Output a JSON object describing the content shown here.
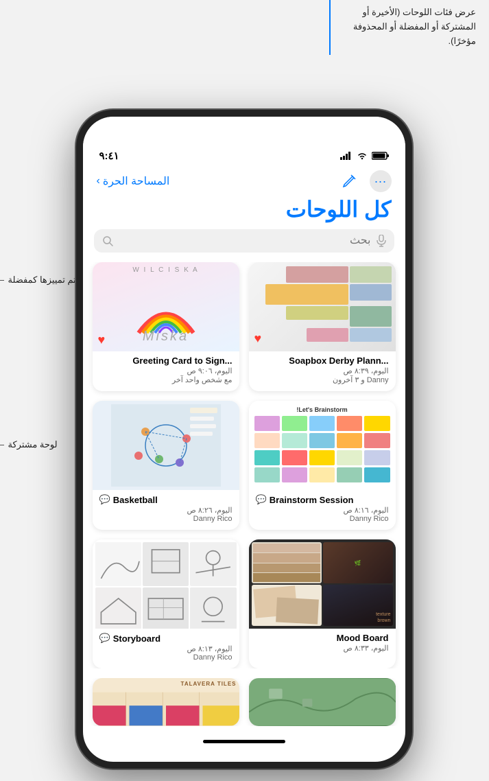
{
  "annotations": {
    "top": {
      "text": "عرض فئات اللوحات (الأخيرة أو المشتركة أو المفضلة أو المحذوفة مؤخرًا)."
    },
    "left_favorite": {
      "text": "لوحة تم تمييزها كمفضلة"
    },
    "left_shared": {
      "text": "لوحة مشتركة"
    }
  },
  "status_bar": {
    "time": "٩:٤١",
    "battery": "██",
    "wifi": "wifi",
    "signal": "signal"
  },
  "nav": {
    "back_label": "المساحة الحرة",
    "more_icon": "⋯",
    "compose_icon": "✎"
  },
  "page_title": "كل اللوحات",
  "search": {
    "placeholder": "بحث",
    "mic_label": "mic"
  },
  "boards": [
    {
      "id": "soapbox",
      "title": "...Soapbox Derby Plann",
      "date": "اليوم، ٨:٣٩ ص",
      "author": "Danny و ٣ آخرون",
      "favorite": true,
      "shared": false,
      "type": "soapbox"
    },
    {
      "id": "greeting",
      "title": "...Greeting Card to Sign",
      "date": "اليوم، ٩:٠٦ ص",
      "author": "مع شخص واحد آخر",
      "favorite": true,
      "shared": false,
      "type": "greeting"
    },
    {
      "id": "brainstorm",
      "title": "Brainstorm Session",
      "date": "اليوم، ٨:١٦ ص",
      "author": "Danny Rico",
      "favorite": false,
      "shared": true,
      "type": "brainstorm"
    },
    {
      "id": "basketball",
      "title": "Basketball",
      "date": "اليوم، ٨:٢٦ ص",
      "author": "Danny Rico",
      "favorite": false,
      "shared": true,
      "type": "basketball"
    },
    {
      "id": "moodboard",
      "title": "Mood Board",
      "date": "اليوم، ٨:٣٣ ص",
      "author": "",
      "favorite": false,
      "shared": false,
      "type": "moodboard"
    },
    {
      "id": "storyboard",
      "title": "Storyboard",
      "date": "اليوم، ٨:١٣ ص",
      "author": "Danny Rico",
      "favorite": false,
      "shared": true,
      "type": "storyboard"
    }
  ],
  "partial_boards": [
    {
      "id": "map",
      "type": "map"
    },
    {
      "id": "talavera",
      "type": "talavera"
    }
  ],
  "home_indicator": ""
}
